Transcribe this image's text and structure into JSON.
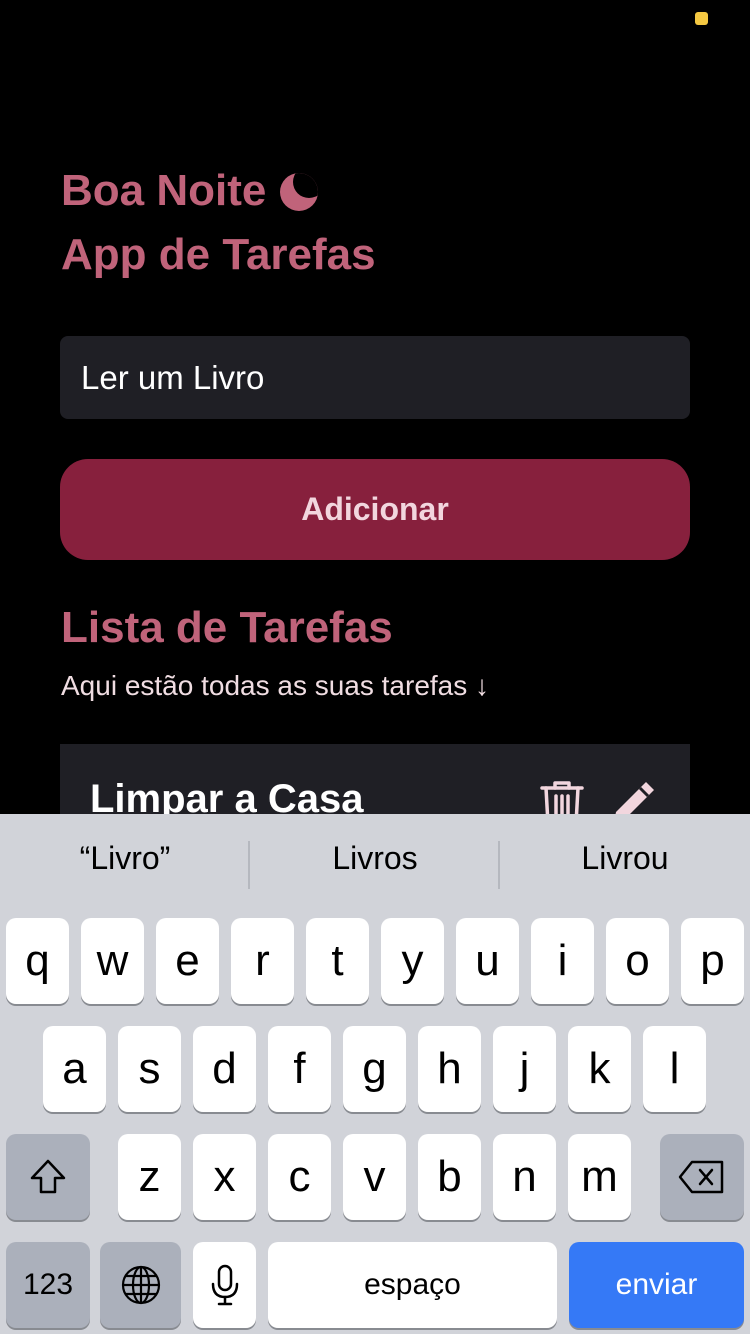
{
  "header": {
    "greeting": "Boa Noite",
    "greeting_icon": "moon-icon",
    "app_title": "App de Tarefas"
  },
  "form": {
    "input_value": "Ler um Livro",
    "add_label": "Adicionar"
  },
  "list": {
    "title": "Lista de Tarefas",
    "subtitle": "Aqui estão todas as suas tarefas ↓",
    "tasks": [
      {
        "title": "Limpar a Casa"
      }
    ]
  },
  "colors": {
    "accent": "#c0637a",
    "button": "#87203d",
    "card": "#1f1f25",
    "keyboard_send": "#3579f6"
  },
  "keyboard": {
    "suggestions": [
      "“Livro”",
      "Livros",
      "Livrou"
    ],
    "row1": [
      "q",
      "w",
      "e",
      "r",
      "t",
      "y",
      "u",
      "i",
      "o",
      "p"
    ],
    "row2": [
      "a",
      "s",
      "d",
      "f",
      "g",
      "h",
      "j",
      "k",
      "l"
    ],
    "row3": [
      "z",
      "x",
      "c",
      "v",
      "b",
      "n",
      "m"
    ],
    "numbers_label": "123",
    "space_label": "espaço",
    "send_label": "enviar"
  }
}
